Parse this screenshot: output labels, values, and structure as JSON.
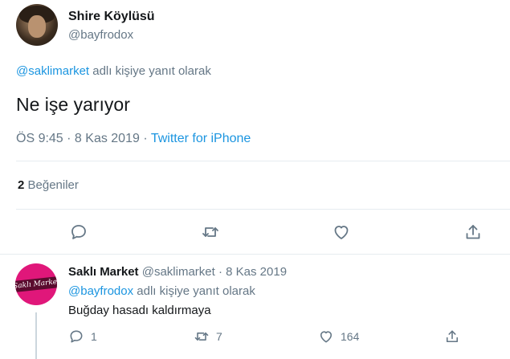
{
  "main_tweet": {
    "author_name": "Shire Köylüsü",
    "author_handle": "@bayfrodox",
    "reply_to_handle": "@saklimarket",
    "reply_context_suffix": " adlı kişiye yanıt olarak",
    "text": "Ne işe yarıyor",
    "time": "ÖS 9:45",
    "separator": " · ",
    "date": "8 Kas 2019",
    "source": "Twitter for iPhone",
    "likes_count": "2",
    "likes_label": " Beğeniler",
    "actions": [
      "reply-icon",
      "retweet-icon",
      "like-icon",
      "share-icon"
    ]
  },
  "reply_tweet": {
    "author_name": "Saklı Market",
    "author_handle": "@saklimarket",
    "separator": " · ",
    "date": "8 Kas 2019",
    "reply_to_handle": "@bayfrodox",
    "reply_context_suffix": " adlı kişiye yanıt olarak",
    "text": "Buğday hasadı kaldırmaya",
    "reply_count": "1",
    "retweet_count": "7",
    "like_count": "164",
    "avatar_logo_text": "Saklı Market"
  },
  "colors": {
    "link": "#1b95e0",
    "muted": "#657786",
    "text": "#14171a",
    "divider": "#e6ecf0",
    "brand_pink": "#e0177a"
  }
}
